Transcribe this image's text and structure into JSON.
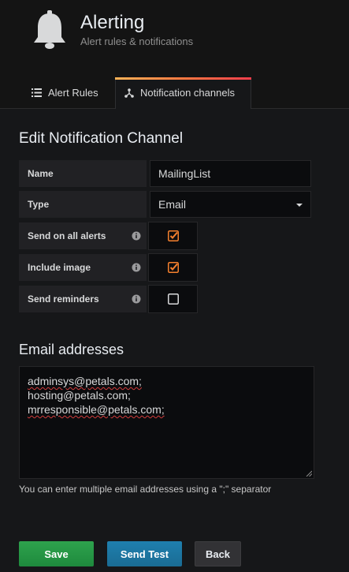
{
  "header": {
    "title": "Alerting",
    "subtitle": "Alert rules & notifications"
  },
  "tabs": [
    {
      "label": "Alert Rules",
      "icon": "list-icon",
      "active": false
    },
    {
      "label": "Notification channels",
      "icon": "share-nodes-icon",
      "active": true
    }
  ],
  "form": {
    "heading": "Edit Notification Channel",
    "name_label": "Name",
    "name_value": "MailingList",
    "type_label": "Type",
    "type_value": "Email",
    "send_all_label": "Send on all alerts",
    "send_all_checked": true,
    "include_image_label": "Include image",
    "include_image_checked": true,
    "send_reminders_label": "Send reminders",
    "send_reminders_checked": false
  },
  "email": {
    "heading": "Email addresses",
    "addresses": [
      "adminsys@petals.com;",
      "hosting@petals.com;",
      "mrresponsible@petals.com;"
    ],
    "hint": "You can enter multiple email addresses using a \";\" separator"
  },
  "buttons": {
    "save": "Save",
    "send_test": "Send Test",
    "back": "Back"
  },
  "colors": {
    "accent_orange": "#f5802d",
    "save_green": "#299c46",
    "test_blue": "#1f78a4"
  }
}
